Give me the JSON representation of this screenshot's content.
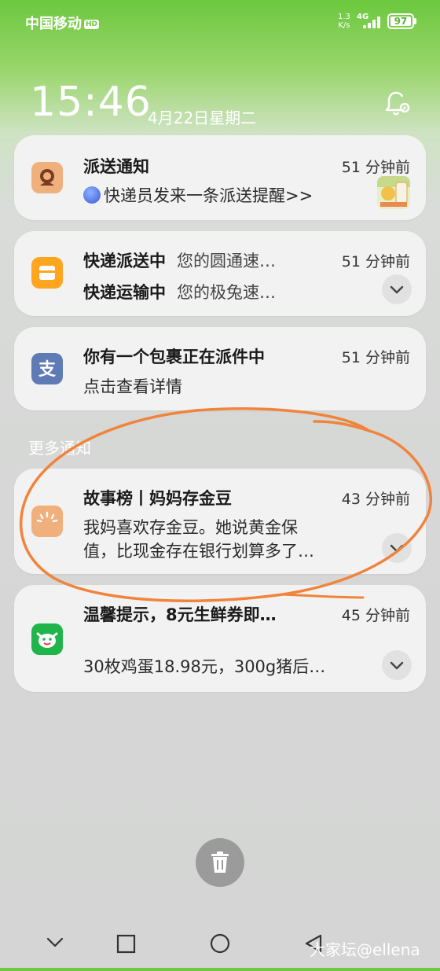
{
  "status_bar": {
    "carrier": "中国移动",
    "hd": "HD",
    "net_speed_value": "1.3",
    "net_speed_unit": "K/s",
    "network": "4G",
    "battery": "97"
  },
  "lockscreen": {
    "time": "15:46",
    "date": "4月22日星期二"
  },
  "notifications": [
    {
      "title": "派送通知",
      "time": "51 分钟前",
      "body": "快递员发来一条派送提醒>>"
    },
    {
      "line1_title": "快递派送中",
      "line1_text": "您的圆通速…",
      "line2_title": "快递运输中",
      "line2_text": "您的极兔速…",
      "time": "51 分钟前"
    },
    {
      "title": "你有一个包裹正在派件中",
      "time": "51 分钟前",
      "body": "点击查看详情"
    }
  ],
  "more_label": "更多通知",
  "more_notifications": [
    {
      "title": "故事榜丨妈妈存金豆",
      "time": "43 分钟前",
      "body_line1": "我妈喜欢存金豆。她说黄金保",
      "body_line2": "值，比现金存在银行划算多了…"
    },
    {
      "title": "温馨提示，8元生鲜券即…",
      "time": "45 分钟前",
      "body": "30枚鸡蛋18.98元，300g猪后…"
    }
  ],
  "watermark": "大家坛@ellena",
  "colors": {
    "status_green": "#6cc83e",
    "card_bg": "#f2f2f2",
    "annotation_orange": "#f0843c"
  }
}
